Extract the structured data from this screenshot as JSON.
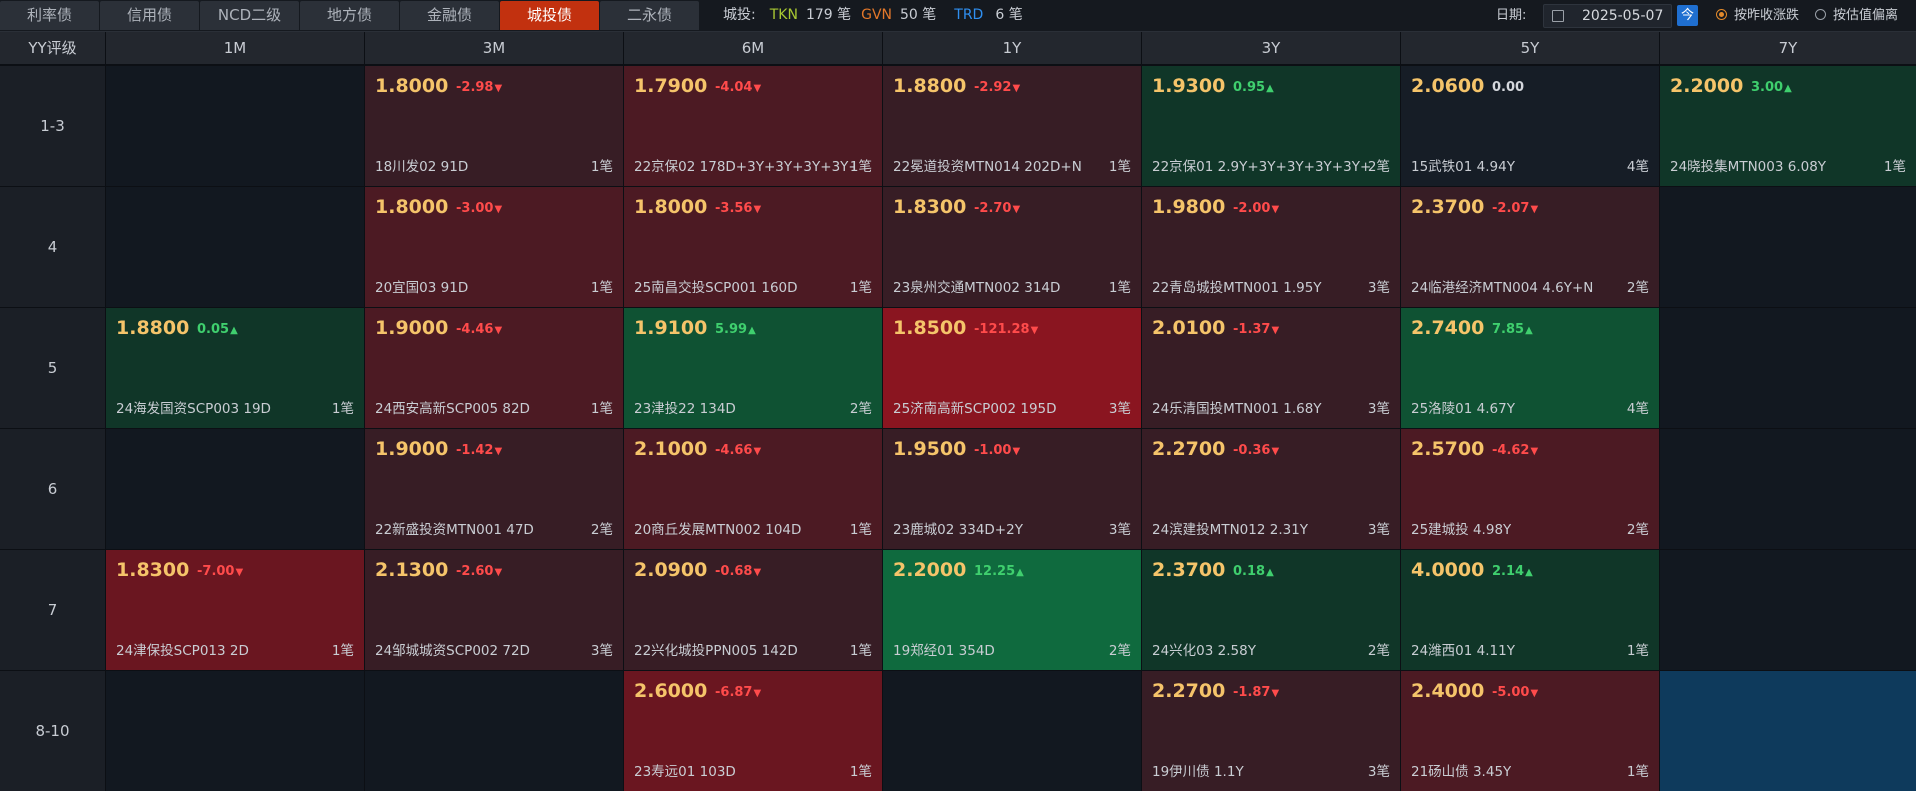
{
  "tabs": [
    {
      "label": "利率债",
      "active": false
    },
    {
      "label": "信用债",
      "active": false
    },
    {
      "label": "NCD二级",
      "active": false
    },
    {
      "label": "地方债",
      "active": false
    },
    {
      "label": "金融债",
      "active": false
    },
    {
      "label": "城投债",
      "active": true
    },
    {
      "label": "二永债",
      "active": false
    }
  ],
  "stats": {
    "prefix": "城投:",
    "tkn_label": "TKN",
    "tkn_count": "179 笔",
    "gvn_label": "GVN",
    "gvn_count": "50 笔",
    "trd_label": "TRD",
    "trd_count": "6 笔"
  },
  "controls": {
    "date_label": "日期:",
    "date_value": "2025-05-07",
    "today_label": "今",
    "radio_1": "按昨收涨跌",
    "radio_2": "按估值偏离",
    "selected": "按昨收涨跌"
  },
  "grid": {
    "corner": "YY评级",
    "columns": [
      "1M",
      "3M",
      "6M",
      "1Y",
      "3Y",
      "5Y",
      "7Y"
    ],
    "rows": [
      {
        "label": "1-3",
        "cells": [
          null,
          {
            "yield": "1.8000",
            "chg": "-2.98",
            "dir": "down",
            "bond": "18川发02 91D",
            "count": "1笔"
          },
          {
            "yield": "1.7900",
            "chg": "-4.04",
            "dir": "down",
            "bond": "22京保02 178D+3Y+3Y+3Y+3Y+3",
            "count": "1笔"
          },
          {
            "yield": "1.8800",
            "chg": "-2.92",
            "dir": "down",
            "bond": "22冕道投资MTN014 202D+N",
            "count": "1笔"
          },
          {
            "yield": "1.9300",
            "chg": "0.95",
            "dir": "up",
            "bond": "22京保01 2.9Y+3Y+3Y+3Y+3Y+3'",
            "count": "2笔"
          },
          {
            "yield": "2.0600",
            "chg": "0.00",
            "dir": "flat",
            "bond": "15武铁01 4.94Y",
            "count": "4笔"
          },
          {
            "yield": "2.2000",
            "chg": "3.00",
            "dir": "up",
            "bond": "24晓投集MTN003 6.08Y",
            "count": "1笔"
          }
        ]
      },
      {
        "label": "4",
        "cells": [
          null,
          {
            "yield": "1.8000",
            "chg": "-3.00",
            "dir": "down",
            "bond": "20宜国03 91D",
            "count": "1笔"
          },
          {
            "yield": "1.8000",
            "chg": "-3.56",
            "dir": "down",
            "bond": "25南昌交投SCP001 160D",
            "count": "1笔"
          },
          {
            "yield": "1.8300",
            "chg": "-2.70",
            "dir": "down",
            "bond": "23泉州交通MTN002 314D",
            "count": "1笔"
          },
          {
            "yield": "1.9800",
            "chg": "-2.00",
            "dir": "down",
            "bond": "22青岛城投MTN001 1.95Y",
            "count": "3笔"
          },
          {
            "yield": "2.3700",
            "chg": "-2.07",
            "dir": "down",
            "bond": "24临港经济MTN004 4.6Y+N",
            "count": "2笔"
          },
          null
        ]
      },
      {
        "label": "5",
        "cells": [
          {
            "yield": "1.8800",
            "chg": "0.05",
            "dir": "up",
            "bond": "24海发国资SCP003 19D",
            "count": "1笔"
          },
          {
            "yield": "1.9000",
            "chg": "-4.46",
            "dir": "down",
            "bond": "24西安高新SCP005 82D",
            "count": "1笔"
          },
          {
            "yield": "1.9100",
            "chg": "5.99",
            "dir": "up",
            "bond": "23津投22 134D",
            "count": "2笔"
          },
          {
            "yield": "1.8500",
            "chg": "-121.28",
            "dir": "down",
            "bond": "25济南高新SCP002 195D",
            "count": "3笔"
          },
          {
            "yield": "2.0100",
            "chg": "-1.37",
            "dir": "down",
            "bond": "24乐清国投MTN001 1.68Y",
            "count": "3笔"
          },
          {
            "yield": "2.7400",
            "chg": "7.85",
            "dir": "up",
            "bond": "25洛陵01 4.67Y",
            "count": "4笔"
          },
          null
        ]
      },
      {
        "label": "6",
        "cells": [
          null,
          {
            "yield": "1.9000",
            "chg": "-1.42",
            "dir": "down",
            "bond": "22新盛投资MTN001 47D",
            "count": "2笔"
          },
          {
            "yield": "2.1000",
            "chg": "-4.66",
            "dir": "down",
            "bond": "20商丘发展MTN002 104D",
            "count": "1笔"
          },
          {
            "yield": "1.9500",
            "chg": "-1.00",
            "dir": "down",
            "bond": "23鹿城02 334D+2Y",
            "count": "3笔"
          },
          {
            "yield": "2.2700",
            "chg": "-0.36",
            "dir": "down",
            "bond": "24滨建投MTN012 2.31Y",
            "count": "3笔"
          },
          {
            "yield": "2.5700",
            "chg": "-4.62",
            "dir": "down",
            "bond": "25建城投 4.98Y",
            "count": "2笔"
          },
          null
        ]
      },
      {
        "label": "7",
        "cells": [
          {
            "yield": "1.8300",
            "chg": "-7.00",
            "dir": "down",
            "bond": "24津保投SCP013 2D",
            "count": "1笔"
          },
          {
            "yield": "2.1300",
            "chg": "-2.60",
            "dir": "down",
            "bond": "24邹城城资SCP002 72D",
            "count": "3笔"
          },
          {
            "yield": "2.0900",
            "chg": "-0.68",
            "dir": "down",
            "bond": "22兴化城投PPN005 142D",
            "count": "1笔"
          },
          {
            "yield": "2.2000",
            "chg": "12.25",
            "dir": "up",
            "bond": "19郑经01 354D",
            "count": "2笔"
          },
          {
            "yield": "2.3700",
            "chg": "0.18",
            "dir": "up",
            "bond": "24兴化03 2.58Y",
            "count": "2笔"
          },
          {
            "yield": "4.0000",
            "chg": "2.14",
            "dir": "up",
            "bond": "24潍西01 4.11Y",
            "count": "1笔"
          },
          null
        ]
      },
      {
        "label": "8-10",
        "cells": [
          null,
          null,
          {
            "yield": "2.6000",
            "chg": "-6.87",
            "dir": "down",
            "bond": "23寿远01 103D",
            "count": "1笔"
          },
          null,
          {
            "yield": "2.2700",
            "chg": "-1.87",
            "dir": "down",
            "bond": "19伊川债 1.1Y",
            "count": "3笔"
          },
          {
            "yield": "2.4000",
            "chg": "-5.00",
            "dir": "down",
            "bond": "21砀山债 3.45Y",
            "count": "1笔"
          },
          {
            "selected_empty": true
          }
        ]
      }
    ]
  },
  "colors": {
    "up": "#3fcf6e",
    "down": "#ff4b4b",
    "yield": "#f5c46a",
    "active_tab": "#c2310f",
    "tkn": "#a8c832",
    "gvn": "#e2772a",
    "trd": "#2f8ff0"
  }
}
